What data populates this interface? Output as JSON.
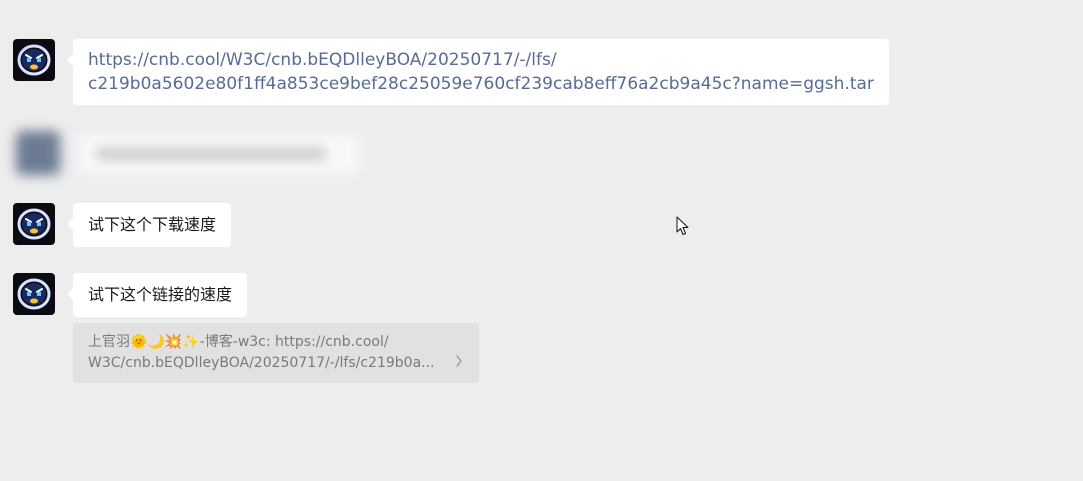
{
  "messages": [
    {
      "type": "link",
      "line1": "https://cnb.cool/W3C/cnb.bEQDlleyBOA/20250717/-/lfs/",
      "line2": "c219b0a5602e80f1ff4a853ce9bef28c25059e760cf239cab8eff76a2cb9a45c?name=ggsh.tar"
    },
    {
      "type": "text",
      "text": "试下这个下载速度"
    },
    {
      "type": "text",
      "text": "试下这个链接的速度"
    }
  ],
  "quote": {
    "line1": "上官羽🌞🌙💥✨-博客-w3c: https://cnb.cool/",
    "line2": "W3C/cnb.bEQDlleyBOA/20250717/-/lfs/c219b0a..."
  },
  "colors": {
    "background": "#ededed",
    "bubble": "#ffffff",
    "link": "#576b95",
    "quote_bg": "#e1e1e1",
    "quote_text": "#7a7a7a"
  },
  "icons": {
    "avatar": "robot-avatar-icon",
    "quote_arrow": "chevron-right-icon",
    "cursor": "mouse-cursor-icon"
  }
}
